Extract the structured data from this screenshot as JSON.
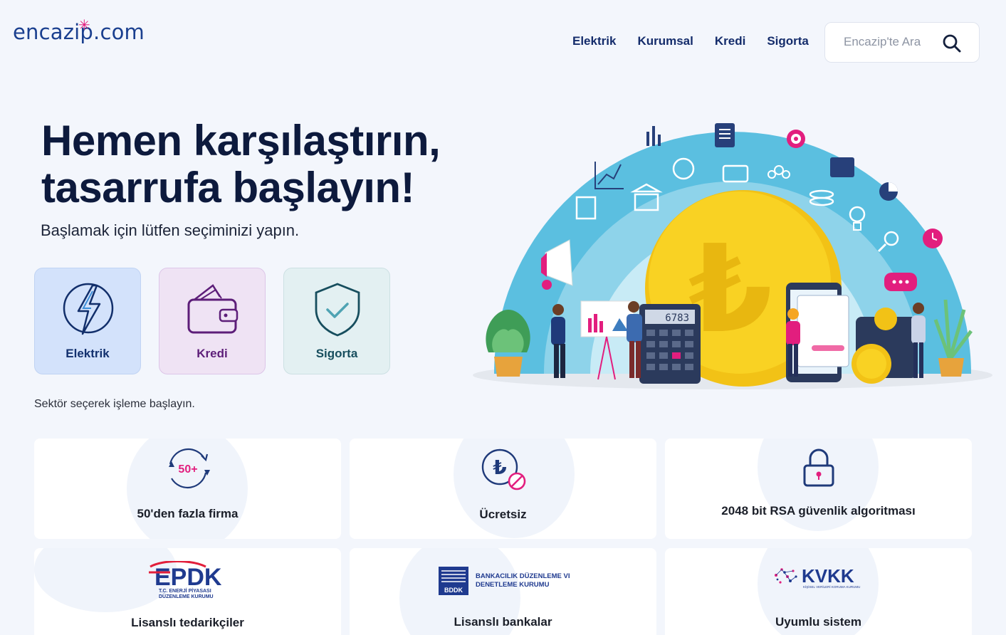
{
  "header": {
    "logo_text": "encazip.com",
    "nav": [
      "Elektrik",
      "Kurumsal",
      "Kredi",
      "Sigorta"
    ],
    "search_placeholder": "Encazip'te Ara"
  },
  "hero": {
    "title_line1": "Hemen karşılaştırın,",
    "title_line2": "tasarrufa başlayın!",
    "subtitle": "Başlamak için lütfen seçiminizi yapın."
  },
  "sectors": [
    {
      "label": "Elektrik",
      "icon": "lightning-icon"
    },
    {
      "label": "Kredi",
      "icon": "wallet-icon"
    },
    {
      "label": "Sigorta",
      "icon": "shield-check-icon"
    }
  ],
  "hint": "Sektör seçerek işleme başlayın.",
  "features": [
    {
      "label": "50'den fazla firma",
      "icon": "cycle-50-icon",
      "badge": "50+"
    },
    {
      "label": "Ücretsiz",
      "icon": "lira-free-icon"
    },
    {
      "label": "2048 bit RSA güvenlik algoritması",
      "icon": "padlock-icon"
    },
    {
      "label": "Lisanslı tedarikçiler",
      "logo": "EPDK",
      "logo_sub1": "T.C. ENERJİ PİYASASI",
      "logo_sub2": "DÜZENLEME KURUMU"
    },
    {
      "label": "Lisanslı bankalar",
      "logo": "BDDK",
      "logo_sub1": "BANKACILIK DÜZENLEME VE",
      "logo_sub2": "DENETLEME KURUMU"
    },
    {
      "label": "Uyumlu sistem",
      "logo": "KVKK",
      "logo_sub1": "KİŞİSEL VERİLERİ KORUMA KURUMU"
    }
  ],
  "illustration": {
    "calculator_display": "6783"
  },
  "colors": {
    "brand": "#1a3f8f",
    "accent": "#e21e7e",
    "coin": "#f9d223",
    "arc": "#5bbfe0"
  }
}
